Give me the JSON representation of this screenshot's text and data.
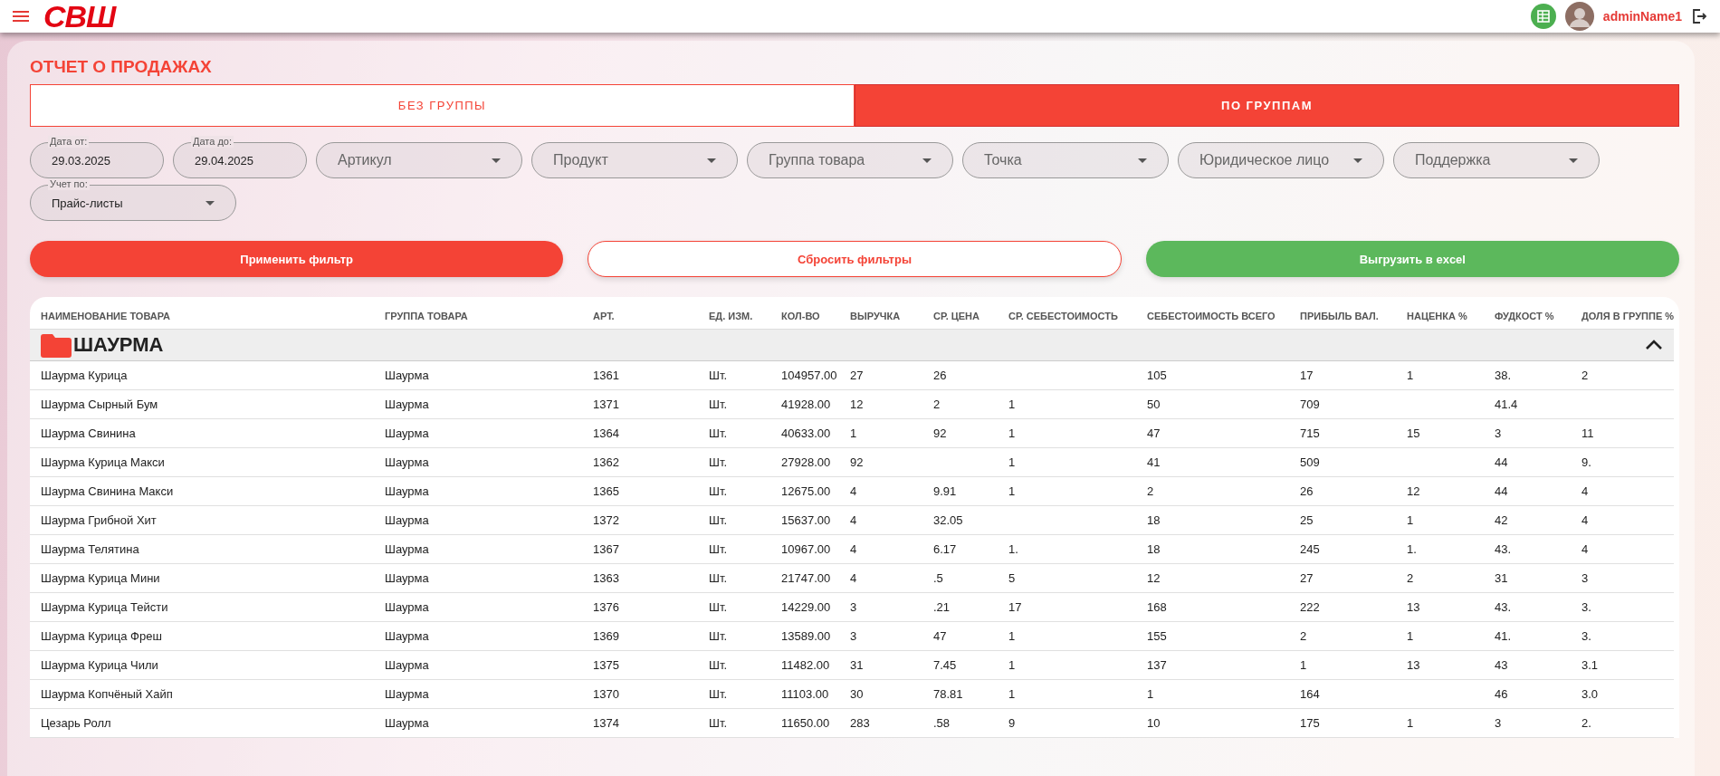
{
  "app_bar": {
    "logo": "СВШ",
    "username": "adminName1"
  },
  "page": {
    "title": "ОТЧЕТ О ПРОДАЖАХ"
  },
  "tabs": [
    {
      "label": "БЕЗ ГРУППЫ",
      "selected": false
    },
    {
      "label": "ПО ГРУППАМ",
      "selected": true
    }
  ],
  "filters": [
    {
      "kind": "date",
      "label": "Дата от:",
      "value": "29.03.2025"
    },
    {
      "kind": "date",
      "label": "Дата до:",
      "value": "29.04.2025"
    },
    {
      "kind": "select",
      "placeholder": "Артикул"
    },
    {
      "kind": "select",
      "placeholder": "Продукт"
    },
    {
      "kind": "select",
      "placeholder": "Группа товара"
    },
    {
      "kind": "select",
      "placeholder": "Точка"
    },
    {
      "kind": "select",
      "placeholder": "Юридическое лицо"
    },
    {
      "kind": "select",
      "placeholder": "Поддержка"
    },
    {
      "kind": "select",
      "label": "Учет по:",
      "value": "Прайс-листы"
    }
  ],
  "actions": [
    {
      "kind": "primary",
      "label": "Применить фильтр"
    },
    {
      "kind": "outline",
      "label": "Сбросить фильтры"
    },
    {
      "kind": "success",
      "label": "Выгрузить в excel"
    }
  ],
  "table": {
    "columns": [
      "НАИМЕНОВАНИЕ ТОВАРА",
      "ГРУППА ТОВАРА",
      "АРТ.",
      "ЕД. ИЗМ.",
      "КОЛ-ВО",
      "ВЫРУЧКА",
      "СР. ЦЕНА",
      "СР. СЕБЕСТОИМОСТЬ",
      "СЕБЕСТОИМОСТЬ ВСЕГО",
      "ПРИБЫЛЬ ВАЛ.",
      "НАЦЕНКА %",
      "ФУДКОСТ %",
      "ДОЛЯ В ГРУППЕ %"
    ],
    "group": {
      "name": "ШАУРМА",
      "expanded": true
    },
    "rows": [
      [
        "Шаурма Курица",
        "Шаурма",
        "1361",
        "Шт.",
        "104957.00",
        "27",
        "26",
        null,
        "105",
        "17",
        "1",
        "38.",
        "2"
      ],
      [
        "Шаурма Сырный Бум",
        "Шаурма",
        "1371",
        "Шт.",
        "41928.00",
        "12",
        "2",
        "1",
        "50",
        "709",
        null,
        "41.4",
        null
      ],
      [
        "Шаурма Свинина",
        "Шаурма",
        "1364",
        "Шт.",
        "40633.00",
        "1",
        "92",
        "1",
        "47",
        "715",
        "15",
        "3",
        "11"
      ],
      [
        "Шаурма Курица Макси",
        "Шаурма",
        "1362",
        "Шт.",
        "27928.00",
        "92",
        null,
        "1",
        "41",
        "509",
        null,
        "44",
        "9."
      ],
      [
        "Шаурма Свинина Макси",
        "Шаурма",
        "1365",
        "Шт.",
        "12675.00",
        "4",
        "9.91",
        "1",
        "2",
        "26",
        "12",
        "44",
        "4"
      ],
      [
        "Шаурма Грибной Хит",
        "Шаурма",
        "1372",
        "Шт.",
        "15637.00",
        "4",
        "32.05",
        null,
        "18",
        "25",
        "1",
        "42",
        "4"
      ],
      [
        "Шаурма Телятина",
        "Шаурма",
        "1367",
        "Шт.",
        "10967.00",
        "4",
        "6.17",
        "1.",
        "18",
        "245",
        "1.",
        "43.",
        "4"
      ],
      [
        "Шаурма Курица Мини",
        "Шаурма",
        "1363",
        "Шт.",
        "21747.00",
        "4",
        ".5",
        "5",
        "12",
        "27",
        "2",
        "31",
        "3"
      ],
      [
        "Шаурма Курица Тейсти",
        "Шаурма",
        "1376",
        "Шт.",
        "14229.00",
        "3",
        ".21",
        "17",
        "168",
        "222",
        "13",
        "43.",
        "3."
      ],
      [
        "Шаурма Курица Фреш",
        "Шаурма",
        "1369",
        "Шт.",
        "13589.00",
        "3",
        "47",
        "1",
        "155",
        "2",
        "1",
        "41.",
        "3."
      ],
      [
        "Шаурма Курица Чили",
        "Шаурма",
        "1375",
        "Шт.",
        "11482.00",
        "31",
        "7.45",
        "1",
        "137",
        "1",
        "13",
        "43",
        "3.1"
      ],
      [
        "Шаурма Копчёный Хайп",
        "Шаурма",
        "1370",
        "Шт.",
        "11103.00",
        "30",
        "78.81",
        "1",
        "1",
        "164",
        null,
        "46",
        "3.0"
      ],
      [
        "Цезарь Ролл",
        "Шаурма",
        "1374",
        "Шт.",
        "11650.00",
        "283",
        ".58",
        "9",
        "10",
        "175",
        "1",
        "3",
        "2."
      ]
    ]
  }
}
